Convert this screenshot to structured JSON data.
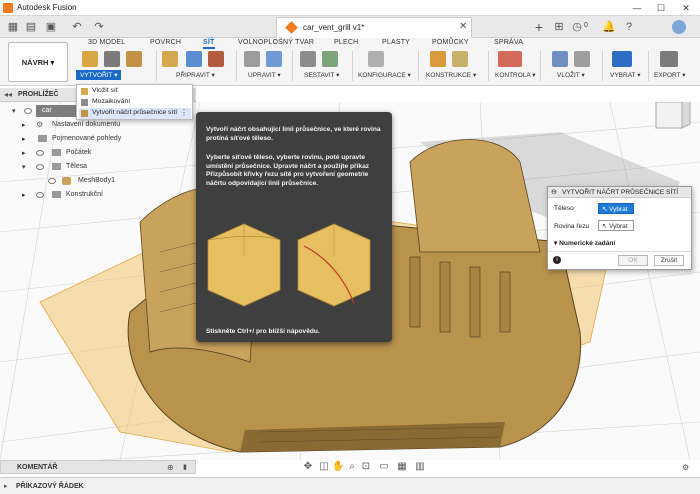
{
  "window": {
    "title": "Autodesk Fusion",
    "minimize": "—",
    "maximize": "☐",
    "close": "✕"
  },
  "document": {
    "name": "car_vent_grill v1*"
  },
  "tabbar": {
    "notification_count": "0"
  },
  "ribbon": {
    "workspace_button": "NÁVRH ▾",
    "tabs": [
      "3D MODEL",
      "POVRCH",
      "SÍŤ",
      "VOLNOPLOŠNÝ TVAR",
      "PLECH",
      "PLASTY",
      "POMŮCKY",
      "SPRÁVA"
    ],
    "active_tab": "SÍŤ",
    "groups": {
      "create": "VYTVOŘIT ▾",
      "prepare": "PŘIPRAVIT ▾",
      "modify": "UPRAVIT ▾",
      "assemble": "SESTAVIT ▾",
      "configure": "KONFIGURACE ▾",
      "construct": "KONSTRUKCE ▾",
      "inspect": "KONTROLA ▾",
      "insert": "VLOŽIT ▾",
      "select": "VYBRAT ▾",
      "export": "EXPORT ▾"
    }
  },
  "create_menu": {
    "items": [
      "Vložit síť",
      "Mozaikování",
      "Vytvořit náčrt průsečnice sítí"
    ]
  },
  "browser": {
    "title": "PROHLÍŽEČ",
    "root": "car",
    "items": [
      "Nastavení dokumentu",
      "Pojmenované pohledy",
      "Počátek",
      "Tělesa",
      "MeshBody1",
      "Konstrukční"
    ]
  },
  "tooltip": {
    "para1": "Vytvoří náčrt obsahující linii průsečnice, ve které rovina protíná síťové těleso.",
    "para2": "Vyberte síťové těleso, vyberte rovinu, poté upravte umístění průsečnice. Upravte náčrt a použijte příkaz Přizpůsobit křivky řezu sítě pro vytvoření geometrie náčrtu odpovídající linii průsečnice.",
    "hint": "Stiskněte Ctrl+/ pro bližší nápovědu."
  },
  "dialog": {
    "title": "VYTVOŘIT NÁČRT PRŮSEČNICE SÍTÍ",
    "body_label": "Těleso",
    "body_button": "Vybrat",
    "plane_label": "Rovina řezu",
    "plane_button": "Vybrat",
    "numeric_section": "Numerické zadání",
    "ok": "OK",
    "cancel": "Zrušit"
  },
  "bottom": {
    "comments": "KOMENTÁŘ",
    "command_line": "PŘÍKAZOVÝ ŘÁDEK"
  },
  "colors": {
    "accent": "#1b6ac9",
    "model": "#c8a04e",
    "tooltip_bg": "#3f3f3f"
  }
}
